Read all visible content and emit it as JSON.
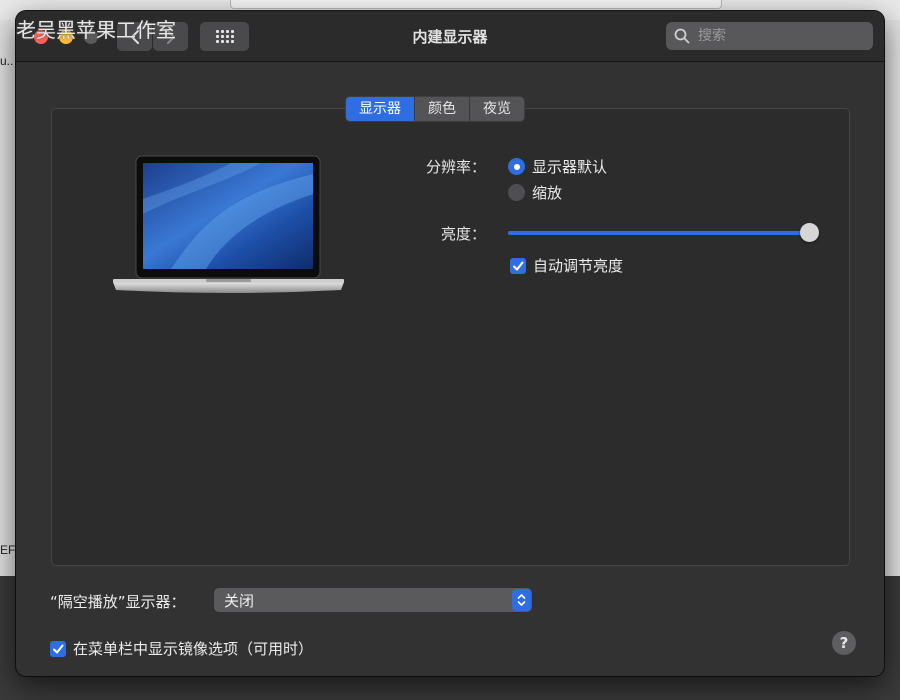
{
  "watermark": "老吴黑苹果工作室",
  "background": {
    "left_texts": [
      "u..",
      "EFI"
    ]
  },
  "window": {
    "title": "内建显示器",
    "search_placeholder": "搜索"
  },
  "tabs": [
    {
      "label": "显示器",
      "active": true
    },
    {
      "label": "颜色",
      "active": false
    },
    {
      "label": "夜览",
      "active": false
    }
  ],
  "resolution": {
    "label": "分辨率：",
    "options": [
      {
        "label": "显示器默认",
        "selected": true
      },
      {
        "label": "缩放",
        "selected": false
      }
    ]
  },
  "brightness": {
    "label": "亮度：",
    "level": 1.0,
    "auto_label": "自动调节亮度",
    "auto_checked": true
  },
  "airplay": {
    "label": "“隔空播放”显示器：",
    "value": "关闭"
  },
  "mirroring": {
    "label": "在菜单栏中显示镜像选项（可用时）",
    "checked": true
  },
  "help": "?",
  "colors": {
    "accent": "#2f6ee0",
    "window_bg": "#323232",
    "panel_bg": "#2c2c2d"
  }
}
